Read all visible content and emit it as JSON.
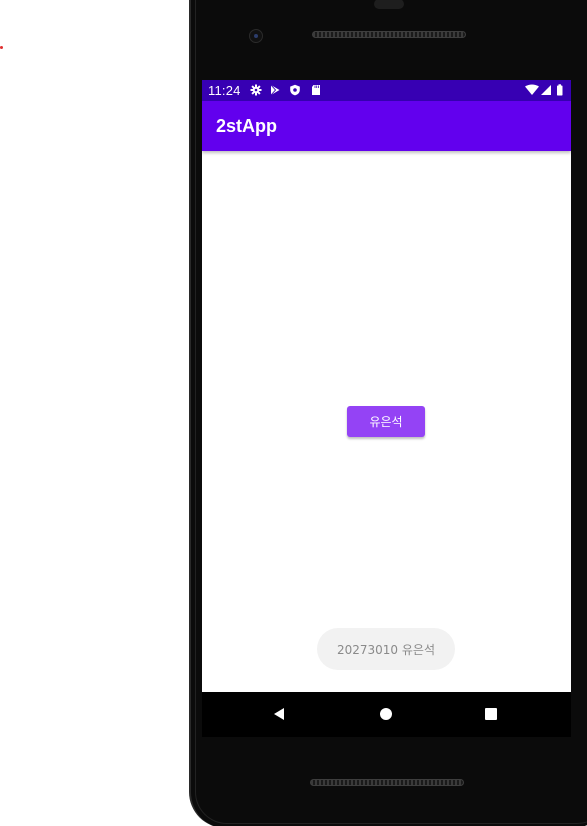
{
  "status_bar": {
    "time": "11:24",
    "left_icons": [
      "gear-icon",
      "play-store-icon",
      "shield-icon",
      "sd-card-icon"
    ],
    "right_icons": [
      "wifi-icon",
      "cell-signal-icon",
      "battery-icon"
    ]
  },
  "app_bar": {
    "title": "2stApp"
  },
  "main": {
    "button_label": "유은석"
  },
  "toast": {
    "message": "20273010 유은석"
  },
  "nav_bar": {
    "buttons": [
      "back-icon",
      "home-icon",
      "recents-icon"
    ]
  },
  "colors": {
    "status_bar": "#3700b3",
    "app_bar": "#6200ee",
    "button": "#9443f5",
    "toast_bg": "#f2f2f2"
  }
}
